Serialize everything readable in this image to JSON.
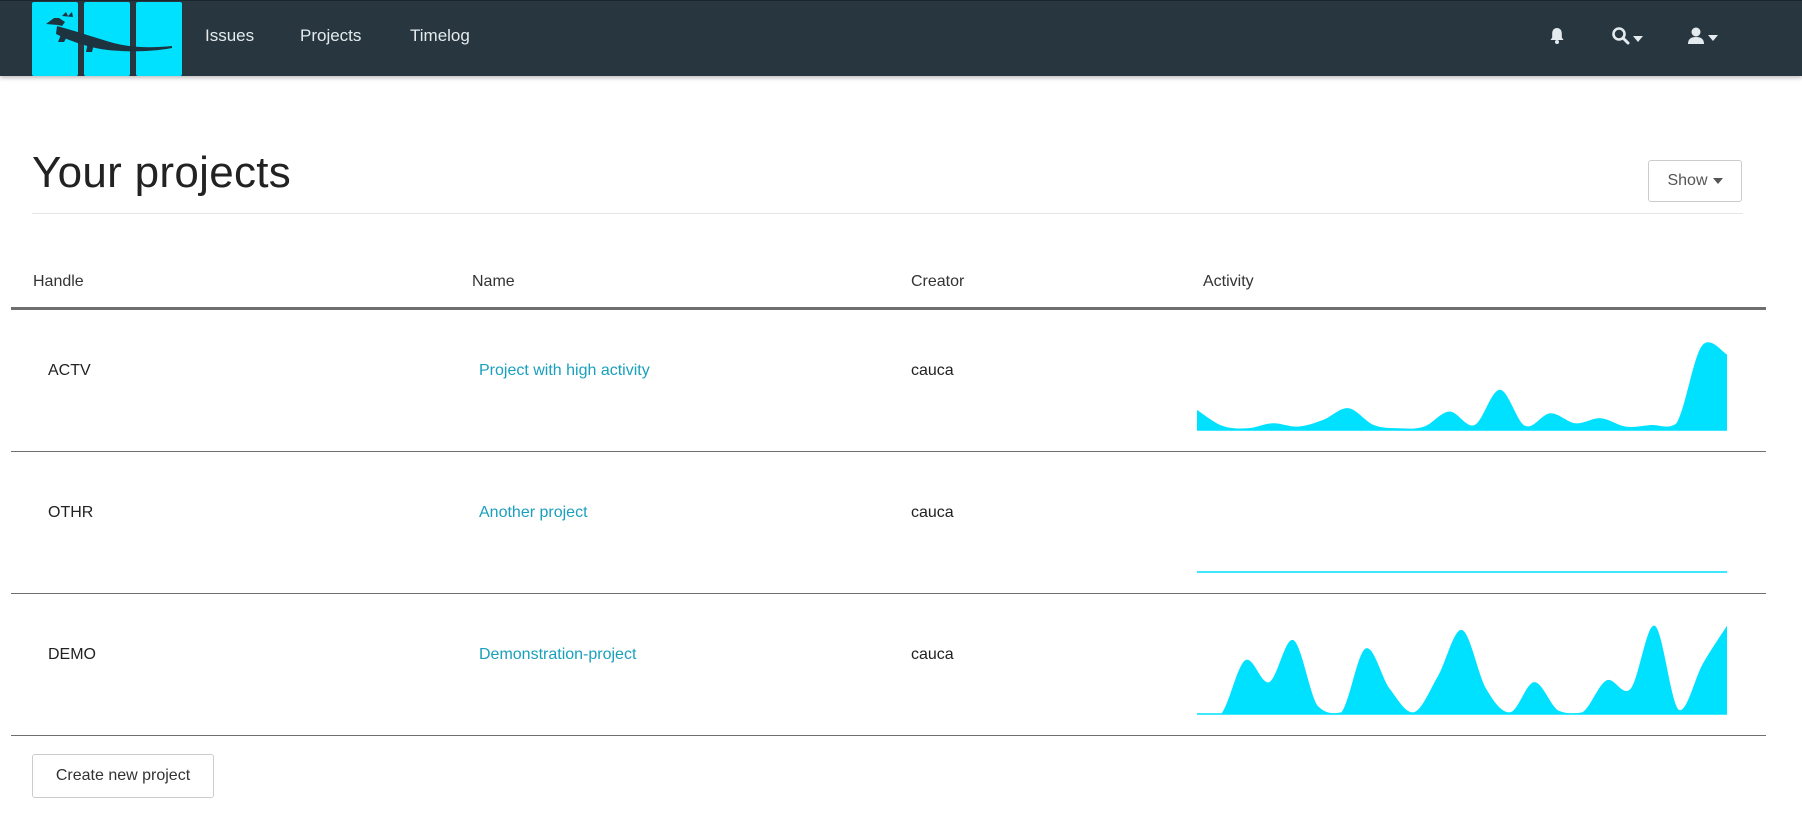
{
  "navbar": {
    "logo": "lizard-logo",
    "links": [
      "Issues",
      "Projects",
      "Timelog"
    ],
    "icons": [
      "bell-icon",
      "search-icon",
      "user-icon"
    ],
    "background": "#28373f",
    "accent": "#00e1ff"
  },
  "page": {
    "title": "Your projects",
    "show_label": "Show"
  },
  "table": {
    "columns": [
      "Handle",
      "Name",
      "Creator",
      "Activity"
    ],
    "rows": [
      {
        "handle": "ACTV",
        "name": "Project with high activity",
        "creator": "cauca",
        "activity": [
          0.24,
          0.05,
          0.02,
          0.08,
          0.04,
          0.12,
          0.26,
          0.06,
          0.02,
          0.04,
          0.22,
          0.06,
          0.48,
          0.05,
          0.2,
          0.08,
          0.14,
          0.04,
          0.06,
          0.08,
          1.0,
          0.9
        ]
      },
      {
        "handle": "OTHR",
        "name": "Another project",
        "creator": "cauca",
        "activity": [
          0,
          0,
          0,
          0,
          0,
          0,
          0,
          0,
          0,
          0,
          0,
          0,
          0,
          0,
          0,
          0,
          0,
          0,
          0,
          0,
          0,
          0
        ]
      },
      {
        "handle": "DEMO",
        "name": "Demonstration-project",
        "creator": "cauca",
        "activity": [
          0.0,
          0.0,
          0.64,
          0.38,
          0.88,
          0.1,
          0.02,
          0.78,
          0.3,
          0.02,
          0.45,
          1.0,
          0.3,
          0.02,
          0.38,
          0.04,
          0.02,
          0.4,
          0.3,
          1.05,
          0.05,
          0.6,
          1.05
        ]
      }
    ],
    "spark_color": "#00e1ff"
  },
  "footer": {
    "create_label": "Create new project"
  }
}
